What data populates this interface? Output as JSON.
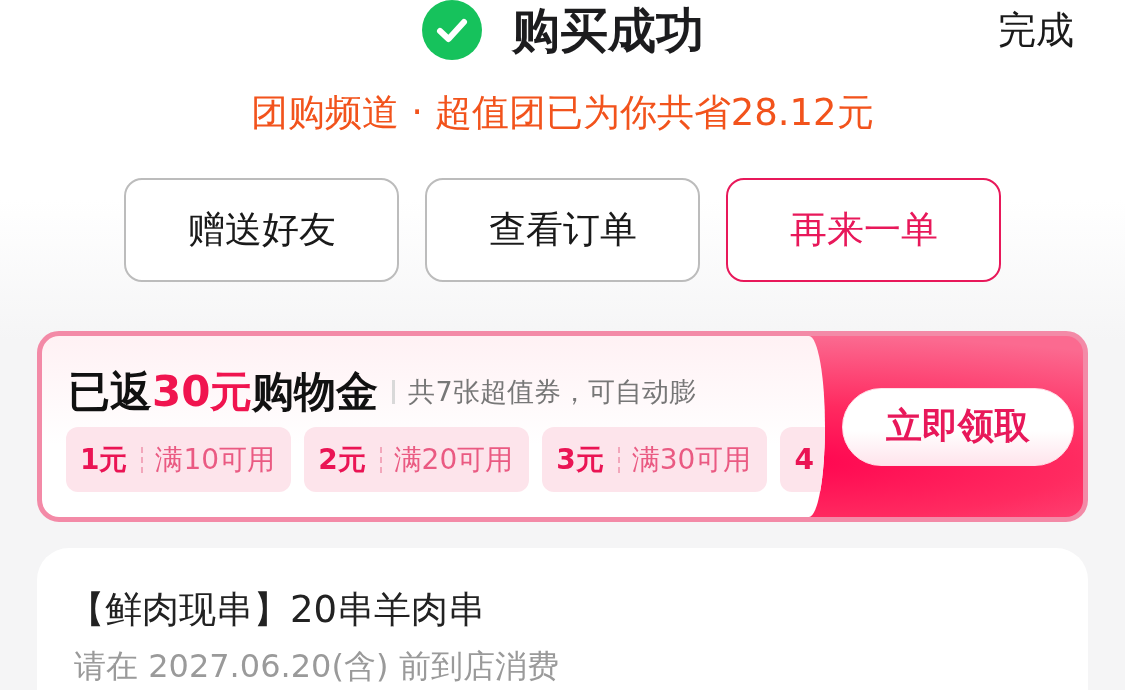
{
  "header": {
    "title": "购买成功",
    "done": "完成"
  },
  "savings": "团购频道 · 超值团已为你共省28.12元",
  "actions": [
    {
      "label": "赠送好友",
      "kind": "plain"
    },
    {
      "label": "查看订单",
      "kind": "plain"
    },
    {
      "label": "再来一单",
      "kind": "primary"
    }
  ],
  "cashback": {
    "title": {
      "prefix": "已返",
      "amount": "30元",
      "suffix": "购物金"
    },
    "subtitle": "共7张超值券，可自动膨",
    "coupons": [
      {
        "value": "1元",
        "condition": "满10可用"
      },
      {
        "value": "2元",
        "condition": "满20可用"
      },
      {
        "value": "3元",
        "condition": "满30可用"
      },
      {
        "value": "4"
      }
    ],
    "claim_button": "立即领取"
  },
  "order": {
    "title": "【鲜肉现串】20串羊肉串",
    "validity": "请在 2027.06.20(含) 前到店消费"
  }
}
